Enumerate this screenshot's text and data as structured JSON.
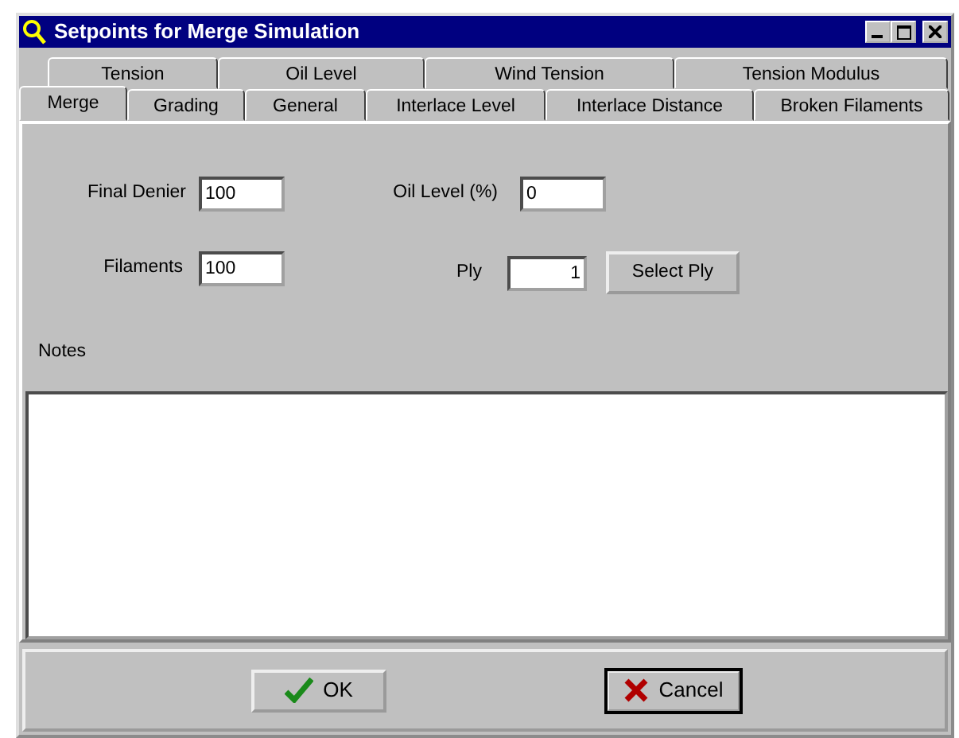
{
  "window": {
    "title": "Setpoints for Merge Simulation"
  },
  "tab_rows": [
    [
      {
        "label": "Tension",
        "selected": false
      },
      {
        "label": "Oil Level",
        "selected": false
      },
      {
        "label": "Wind Tension",
        "selected": false
      },
      {
        "label": "Tension Modulus",
        "selected": false
      }
    ],
    [
      {
        "label": "Merge",
        "selected": true
      },
      {
        "label": "Grading",
        "selected": false
      },
      {
        "label": "General",
        "selected": false
      },
      {
        "label": "Interlace Level",
        "selected": false
      },
      {
        "label": "Interlace Distance",
        "selected": false
      },
      {
        "label": "Broken Filaments",
        "selected": false
      }
    ]
  ],
  "fields": {
    "final_denier": {
      "label": "Final Denier",
      "value": "100"
    },
    "filaments": {
      "label": "Filaments",
      "value": "100"
    },
    "oil_level": {
      "label": "Oil Level (%)",
      "value": "0"
    },
    "ply": {
      "label": "Ply",
      "value": "1"
    }
  },
  "select_ply_button": "Select Ply",
  "notes": {
    "label": "Notes"
  },
  "buttons": [
    {
      "kind": "ok",
      "label": "OK",
      "focused": false
    },
    {
      "kind": "cancel",
      "label": "Cancel",
      "focused": true
    }
  ]
}
